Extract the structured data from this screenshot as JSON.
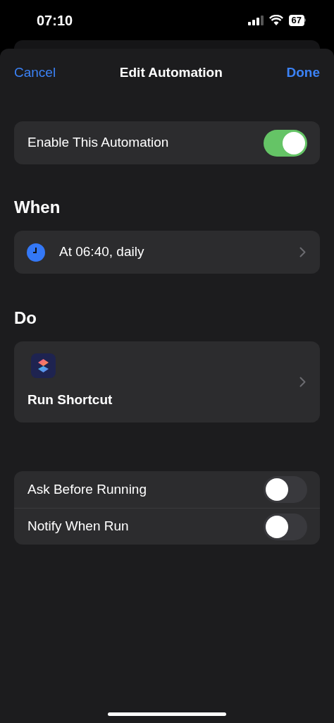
{
  "status_bar": {
    "time": "07:10",
    "battery": "67"
  },
  "nav": {
    "cancel": "Cancel",
    "title": "Edit Automation",
    "done": "Done"
  },
  "enable": {
    "label": "Enable This Automation",
    "on": true
  },
  "when": {
    "heading": "When",
    "trigger": "At 06:40, daily"
  },
  "do": {
    "heading": "Do",
    "action": "Run Shortcut"
  },
  "options": [
    {
      "label": "Ask Before Running",
      "on": false
    },
    {
      "label": "Notify When Run",
      "on": false
    }
  ]
}
